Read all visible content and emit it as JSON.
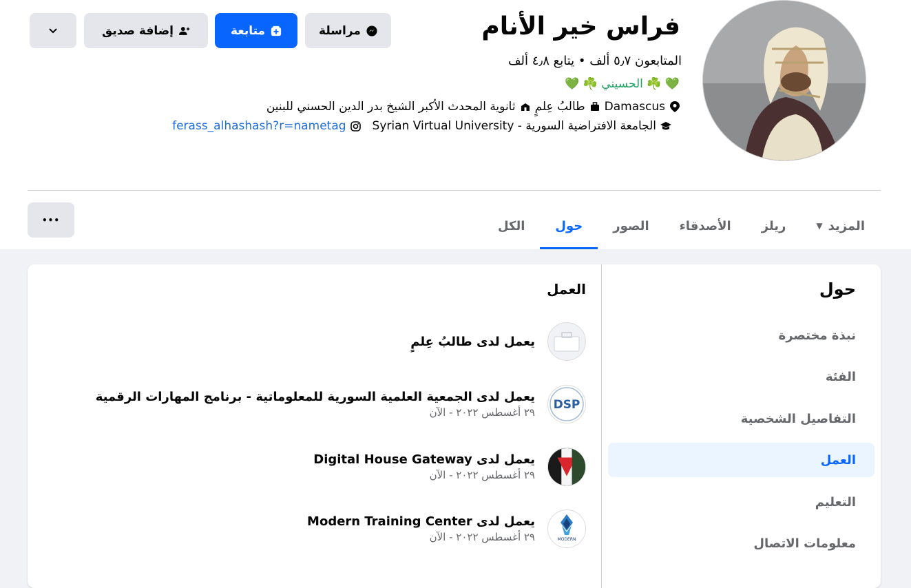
{
  "profile": {
    "name": "فراس خير الأنام",
    "stats": "المتابعون ٥٫٧ ألف • يتابع ٤٫٨ ألف",
    "bio": "💚 ☘️ الحسيني ☘️ 💚",
    "location": "Damascus",
    "work_1": "طالبُ عِلمٍ",
    "school": "ثانوية المحدث الأكبر الشيخ بدر الدين الحسني للبنين",
    "university": "الجامعة الافتراضية السورية - Syrian Virtual University",
    "instagram": "ferass_alhashash?r=nametag"
  },
  "actions": {
    "message": "مراسلة",
    "follow": "متابعة",
    "add_friend": "إضافة صديق"
  },
  "tabs": [
    {
      "label": "الكل",
      "active": false
    },
    {
      "label": "حول",
      "active": true
    },
    {
      "label": "الصور",
      "active": false
    },
    {
      "label": "الأصدقاء",
      "active": false
    },
    {
      "label": "ريلز",
      "active": false
    },
    {
      "label": "المزيد",
      "active": false
    }
  ],
  "more_dots": "•••",
  "about": {
    "title": "حول",
    "items": [
      {
        "label": "نبذة مختصرة",
        "active": false
      },
      {
        "label": "الفئة",
        "active": false
      },
      {
        "label": "التفاصيل الشخصية",
        "active": false
      },
      {
        "label": "العمل",
        "active": true
      },
      {
        "label": "التعليم",
        "active": false
      },
      {
        "label": "معلومات الاتصال",
        "active": false
      }
    ]
  },
  "work": {
    "title": "العمل",
    "jobs": [
      {
        "title": "يعمل لدى طالبُ عِلمٍ",
        "date": ""
      },
      {
        "title": "يعمل لدى الجمعية العلمية السورية للمعلوماتية - برنامج المهارات الرقمية",
        "date": "٢٩ أغسطس ٢٠٢٢ - الآن"
      },
      {
        "title": "يعمل لدى Digital House Gateway",
        "date": "٢٩ أغسطس ٢٠٢٢ - الآن"
      },
      {
        "title": "يعمل لدى Modern Training Center",
        "date": "٢٩ أغسطس ٢٠٢٢ - الآن"
      }
    ],
    "logo_texts": {
      "dsp": "DSP",
      "modern": "MODERN"
    }
  },
  "colors": {
    "accent": "#0866ff",
    "secondary_text": "#65676b",
    "active_bg": "#ebf5ff"
  }
}
